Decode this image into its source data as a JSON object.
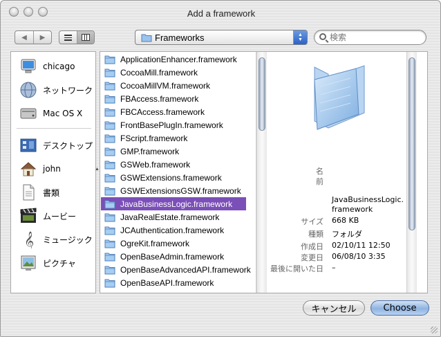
{
  "window": {
    "title": "Add a framework"
  },
  "toolbar": {
    "back_glyph": "◀",
    "forward_glyph": "▶",
    "location": "Frameworks",
    "search_placeholder": "検索"
  },
  "sidebar": {
    "devices": [
      {
        "label": "chicago",
        "icon": "computer-icon"
      },
      {
        "label": "ネットワーク",
        "icon": "network-globe-icon"
      },
      {
        "label": "Mac OS X",
        "icon": "hard-disk-icon"
      }
    ],
    "places": [
      {
        "label": "デスクトップ",
        "icon": "desktop-icon"
      },
      {
        "label": "john",
        "icon": "home-icon"
      },
      {
        "label": "書類",
        "icon": "documents-icon"
      },
      {
        "label": "ムービー",
        "icon": "movies-icon"
      },
      {
        "label": "ミュージック",
        "icon": "music-icon"
      },
      {
        "label": "ピクチャ",
        "icon": "pictures-icon"
      }
    ]
  },
  "files": [
    "ApplicationEnhancer.framework",
    "CocoaMill.framework",
    "CocoaMillVM.framework",
    "FBAccess.framework",
    "FBCAccess.framework",
    "FrontBasePlugIn.framework",
    "FScript.framework",
    "GMP.framework",
    "GSWeb.framework",
    "GSWExtensions.framework",
    "GSWExtensionsGSW.framework",
    "JavaBusinessLogic.framework",
    "JavaRealEstate.framework",
    "JCAuthentication.framework",
    "OgreKit.framework",
    "OpenBaseAdmin.framework",
    "OpenBaseAdvancedAPI.framework",
    "OpenBaseAPI.framework"
  ],
  "selected_index": 11,
  "preview": {
    "name_label_1": "名",
    "name_label_2": "前",
    "name_value_1": "JavaBusinessLogic.",
    "name_value_2": "framework",
    "size_label": "サイズ",
    "size_value": "668 KB",
    "kind_label": "種類",
    "kind_value": "フォルダ",
    "created_label": "作成日",
    "created_value": "02/10/11 12:50",
    "modified_label": "変更日",
    "modified_value": "06/08/10 3:35",
    "last_opened_label": "最後に開いた日",
    "last_opened_value": "–"
  },
  "buttons": {
    "cancel": "キャンセル",
    "choose": "Choose"
  },
  "colors": {
    "selection": "#7b4fb8",
    "default_button": "#8fb3e0"
  }
}
